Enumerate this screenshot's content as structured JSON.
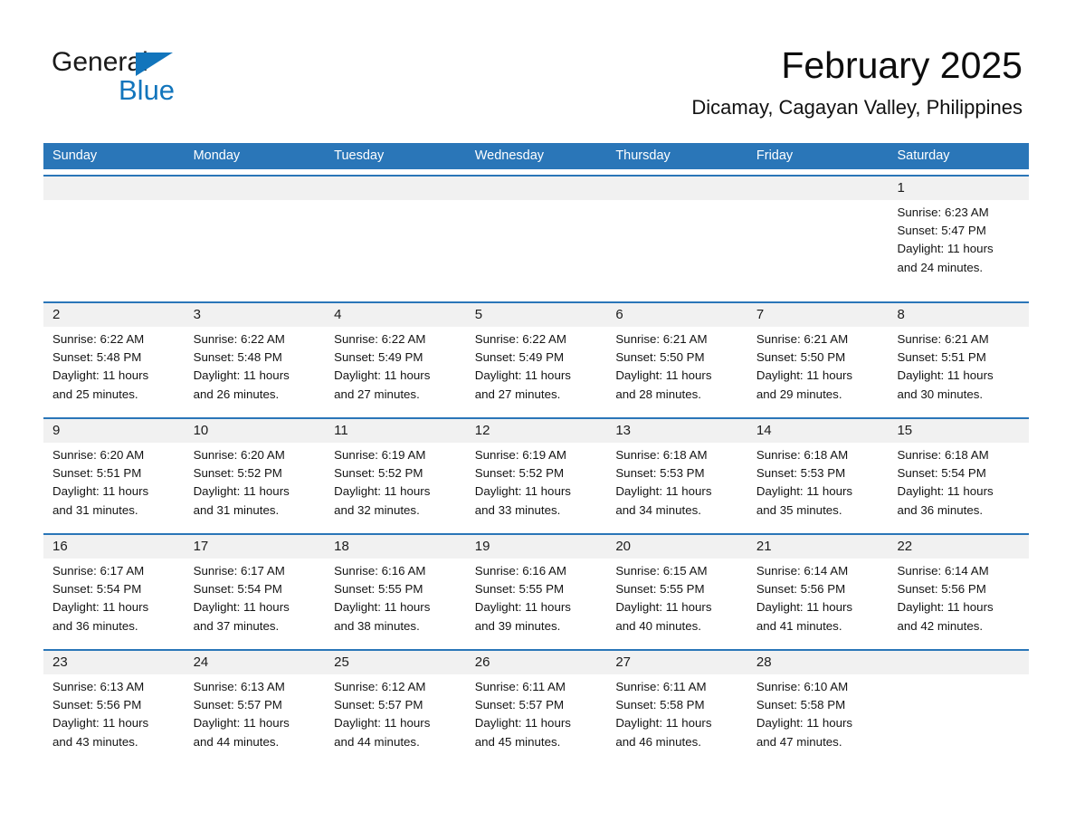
{
  "brand": {
    "name_part1": "General",
    "name_part2": "Blue",
    "triangle_color": "#1275bc"
  },
  "header": {
    "title": "February 2025",
    "subtitle": "Dicamay, Cagayan Valley, Philippines",
    "accent_color": "#2a76b8"
  },
  "calendar": {
    "weekday_headers": [
      "Sunday",
      "Monday",
      "Tuesday",
      "Wednesday",
      "Thursday",
      "Friday",
      "Saturday"
    ],
    "weeks": [
      [
        {
          "day": "",
          "sunrise": "",
          "sunset": "",
          "daylight_line1": "",
          "daylight_line2": ""
        },
        {
          "day": "",
          "sunrise": "",
          "sunset": "",
          "daylight_line1": "",
          "daylight_line2": ""
        },
        {
          "day": "",
          "sunrise": "",
          "sunset": "",
          "daylight_line1": "",
          "daylight_line2": ""
        },
        {
          "day": "",
          "sunrise": "",
          "sunset": "",
          "daylight_line1": "",
          "daylight_line2": ""
        },
        {
          "day": "",
          "sunrise": "",
          "sunset": "",
          "daylight_line1": "",
          "daylight_line2": ""
        },
        {
          "day": "",
          "sunrise": "",
          "sunset": "",
          "daylight_line1": "",
          "daylight_line2": ""
        },
        {
          "day": "1",
          "sunrise": "Sunrise: 6:23 AM",
          "sunset": "Sunset: 5:47 PM",
          "daylight_line1": "Daylight: 11 hours",
          "daylight_line2": "and 24 minutes."
        }
      ],
      [
        {
          "day": "2",
          "sunrise": "Sunrise: 6:22 AM",
          "sunset": "Sunset: 5:48 PM",
          "daylight_line1": "Daylight: 11 hours",
          "daylight_line2": "and 25 minutes."
        },
        {
          "day": "3",
          "sunrise": "Sunrise: 6:22 AM",
          "sunset": "Sunset: 5:48 PM",
          "daylight_line1": "Daylight: 11 hours",
          "daylight_line2": "and 26 minutes."
        },
        {
          "day": "4",
          "sunrise": "Sunrise: 6:22 AM",
          "sunset": "Sunset: 5:49 PM",
          "daylight_line1": "Daylight: 11 hours",
          "daylight_line2": "and 27 minutes."
        },
        {
          "day": "5",
          "sunrise": "Sunrise: 6:22 AM",
          "sunset": "Sunset: 5:49 PM",
          "daylight_line1": "Daylight: 11 hours",
          "daylight_line2": "and 27 minutes."
        },
        {
          "day": "6",
          "sunrise": "Sunrise: 6:21 AM",
          "sunset": "Sunset: 5:50 PM",
          "daylight_line1": "Daylight: 11 hours",
          "daylight_line2": "and 28 minutes."
        },
        {
          "day": "7",
          "sunrise": "Sunrise: 6:21 AM",
          "sunset": "Sunset: 5:50 PM",
          "daylight_line1": "Daylight: 11 hours",
          "daylight_line2": "and 29 minutes."
        },
        {
          "day": "8",
          "sunrise": "Sunrise: 6:21 AM",
          "sunset": "Sunset: 5:51 PM",
          "daylight_line1": "Daylight: 11 hours",
          "daylight_line2": "and 30 minutes."
        }
      ],
      [
        {
          "day": "9",
          "sunrise": "Sunrise: 6:20 AM",
          "sunset": "Sunset: 5:51 PM",
          "daylight_line1": "Daylight: 11 hours",
          "daylight_line2": "and 31 minutes."
        },
        {
          "day": "10",
          "sunrise": "Sunrise: 6:20 AM",
          "sunset": "Sunset: 5:52 PM",
          "daylight_line1": "Daylight: 11 hours",
          "daylight_line2": "and 31 minutes."
        },
        {
          "day": "11",
          "sunrise": "Sunrise: 6:19 AM",
          "sunset": "Sunset: 5:52 PM",
          "daylight_line1": "Daylight: 11 hours",
          "daylight_line2": "and 32 minutes."
        },
        {
          "day": "12",
          "sunrise": "Sunrise: 6:19 AM",
          "sunset": "Sunset: 5:52 PM",
          "daylight_line1": "Daylight: 11 hours",
          "daylight_line2": "and 33 minutes."
        },
        {
          "day": "13",
          "sunrise": "Sunrise: 6:18 AM",
          "sunset": "Sunset: 5:53 PM",
          "daylight_line1": "Daylight: 11 hours",
          "daylight_line2": "and 34 minutes."
        },
        {
          "day": "14",
          "sunrise": "Sunrise: 6:18 AM",
          "sunset": "Sunset: 5:53 PM",
          "daylight_line1": "Daylight: 11 hours",
          "daylight_line2": "and 35 minutes."
        },
        {
          "day": "15",
          "sunrise": "Sunrise: 6:18 AM",
          "sunset": "Sunset: 5:54 PM",
          "daylight_line1": "Daylight: 11 hours",
          "daylight_line2": "and 36 minutes."
        }
      ],
      [
        {
          "day": "16",
          "sunrise": "Sunrise: 6:17 AM",
          "sunset": "Sunset: 5:54 PM",
          "daylight_line1": "Daylight: 11 hours",
          "daylight_line2": "and 36 minutes."
        },
        {
          "day": "17",
          "sunrise": "Sunrise: 6:17 AM",
          "sunset": "Sunset: 5:54 PM",
          "daylight_line1": "Daylight: 11 hours",
          "daylight_line2": "and 37 minutes."
        },
        {
          "day": "18",
          "sunrise": "Sunrise: 6:16 AM",
          "sunset": "Sunset: 5:55 PM",
          "daylight_line1": "Daylight: 11 hours",
          "daylight_line2": "and 38 minutes."
        },
        {
          "day": "19",
          "sunrise": "Sunrise: 6:16 AM",
          "sunset": "Sunset: 5:55 PM",
          "daylight_line1": "Daylight: 11 hours",
          "daylight_line2": "and 39 minutes."
        },
        {
          "day": "20",
          "sunrise": "Sunrise: 6:15 AM",
          "sunset": "Sunset: 5:55 PM",
          "daylight_line1": "Daylight: 11 hours",
          "daylight_line2": "and 40 minutes."
        },
        {
          "day": "21",
          "sunrise": "Sunrise: 6:14 AM",
          "sunset": "Sunset: 5:56 PM",
          "daylight_line1": "Daylight: 11 hours",
          "daylight_line2": "and 41 minutes."
        },
        {
          "day": "22",
          "sunrise": "Sunrise: 6:14 AM",
          "sunset": "Sunset: 5:56 PM",
          "daylight_line1": "Daylight: 11 hours",
          "daylight_line2": "and 42 minutes."
        }
      ],
      [
        {
          "day": "23",
          "sunrise": "Sunrise: 6:13 AM",
          "sunset": "Sunset: 5:56 PM",
          "daylight_line1": "Daylight: 11 hours",
          "daylight_line2": "and 43 minutes."
        },
        {
          "day": "24",
          "sunrise": "Sunrise: 6:13 AM",
          "sunset": "Sunset: 5:57 PM",
          "daylight_line1": "Daylight: 11 hours",
          "daylight_line2": "and 44 minutes."
        },
        {
          "day": "25",
          "sunrise": "Sunrise: 6:12 AM",
          "sunset": "Sunset: 5:57 PM",
          "daylight_line1": "Daylight: 11 hours",
          "daylight_line2": "and 44 minutes."
        },
        {
          "day": "26",
          "sunrise": "Sunrise: 6:11 AM",
          "sunset": "Sunset: 5:57 PM",
          "daylight_line1": "Daylight: 11 hours",
          "daylight_line2": "and 45 minutes."
        },
        {
          "day": "27",
          "sunrise": "Sunrise: 6:11 AM",
          "sunset": "Sunset: 5:58 PM",
          "daylight_line1": "Daylight: 11 hours",
          "daylight_line2": "and 46 minutes."
        },
        {
          "day": "28",
          "sunrise": "Sunrise: 6:10 AM",
          "sunset": "Sunset: 5:58 PM",
          "daylight_line1": "Daylight: 11 hours",
          "daylight_line2": "and 47 minutes."
        },
        {
          "day": "",
          "sunrise": "",
          "sunset": "",
          "daylight_line1": "",
          "daylight_line2": ""
        }
      ]
    ]
  }
}
